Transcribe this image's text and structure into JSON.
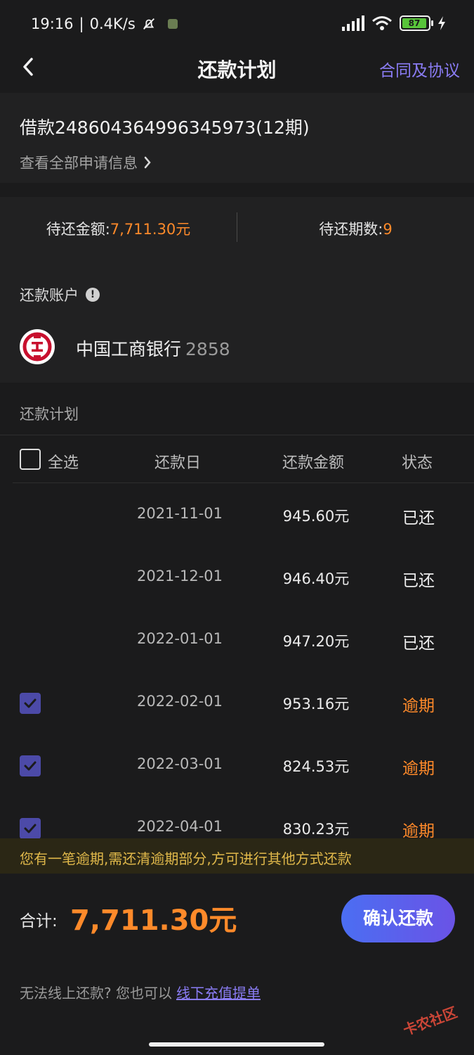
{
  "status_bar": {
    "time": "19:16",
    "net_speed": "0.4K/s",
    "battery": "87"
  },
  "nav": {
    "title": "还款计划",
    "link": "合同及协议"
  },
  "loan": {
    "title": "借款248604364996345973(12期)",
    "view_all": "查看全部申请信息"
  },
  "summary": {
    "due_amount_label": "待还金额:",
    "due_amount_value": "7,711.30元",
    "due_periods_label": "待还期数:",
    "due_periods_value": "9"
  },
  "account": {
    "label": "还款账户",
    "bank_name": "中国工商银行",
    "card_tail": "2858"
  },
  "plan": {
    "label": "还款计划",
    "headers": {
      "select_all": "全选",
      "date": "还款日",
      "amount": "还款金额",
      "status": "状态"
    },
    "rows": [
      {
        "date": "2021-11-01",
        "amount": "945.60元",
        "status": "已还",
        "overdue": false,
        "checked": false
      },
      {
        "date": "2021-12-01",
        "amount": "946.40元",
        "status": "已还",
        "overdue": false,
        "checked": false
      },
      {
        "date": "2022-01-01",
        "amount": "947.20元",
        "status": "已还",
        "overdue": false,
        "checked": false
      },
      {
        "date": "2022-02-01",
        "amount": "953.16元",
        "status": "逾期",
        "overdue": true,
        "checked": true
      },
      {
        "date": "2022-03-01",
        "amount": "824.53元",
        "status": "逾期",
        "overdue": true,
        "checked": true
      },
      {
        "date": "2022-04-01",
        "amount": "830.23元",
        "status": "逾期",
        "overdue": true,
        "checked": true
      }
    ]
  },
  "notice": "您有一笔逾期,需还清逾期部分,方可进行其他方式还款",
  "footer": {
    "total_label": "合计:",
    "total_value": "7,711.30元",
    "confirm_button": "确认还款",
    "offline_prefix": "无法线上还款? 您也可以",
    "offline_link": "线下充值提单",
    "watermark": "卡农社区"
  },
  "colors": {
    "accent_orange": "#ff8a2a",
    "link_purple": "#8a7cf4",
    "button_gradient_start": "#4b6ef2",
    "button_gradient_end": "#6a53e6",
    "checkbox_checked": "#4c4aa8"
  }
}
